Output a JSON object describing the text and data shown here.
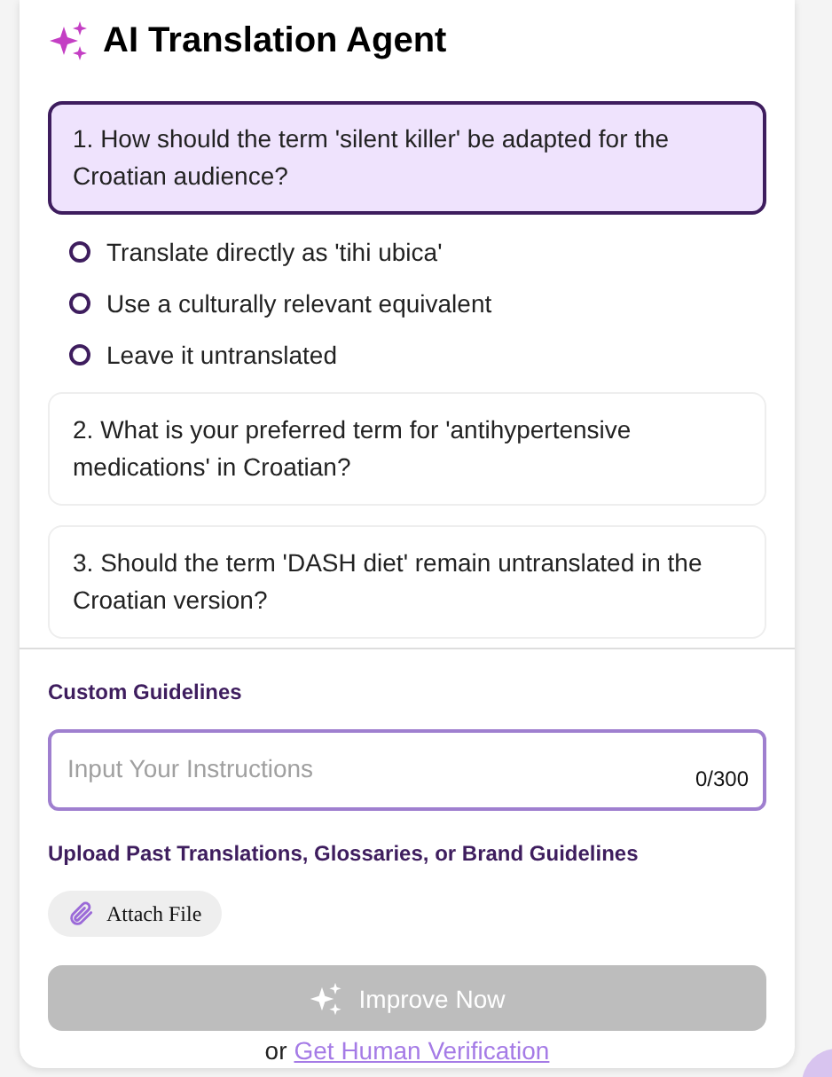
{
  "header": {
    "title": "AI Translation Agent"
  },
  "questions": [
    {
      "text": "1. How should the term 'silent killer' be adapted for the Croatian audience?",
      "selected": true,
      "options": [
        {
          "label": "Translate directly as 'tihi ubica'",
          "selected": false
        },
        {
          "label": "Use a culturally relevant equivalent",
          "selected": false
        },
        {
          "label": "Leave it untranslated",
          "selected": false
        }
      ]
    },
    {
      "text": "2. What is your preferred term for 'antihypertensive medications' in Croatian?",
      "selected": false
    },
    {
      "text": "3. Should the term 'DASH diet' remain untranslated in the Croatian version?",
      "selected": false
    }
  ],
  "guidelines": {
    "label": "Custom Guidelines",
    "placeholder": "Input Your Instructions",
    "counter": "0/300"
  },
  "upload": {
    "label": "Upload Past Translations, Glossaries, or Brand Guidelines",
    "button": "Attach File"
  },
  "submit": {
    "label": "Improve Now",
    "disabled": true
  },
  "footer": {
    "prefix": "or",
    "link": "Get Human Verification"
  }
}
